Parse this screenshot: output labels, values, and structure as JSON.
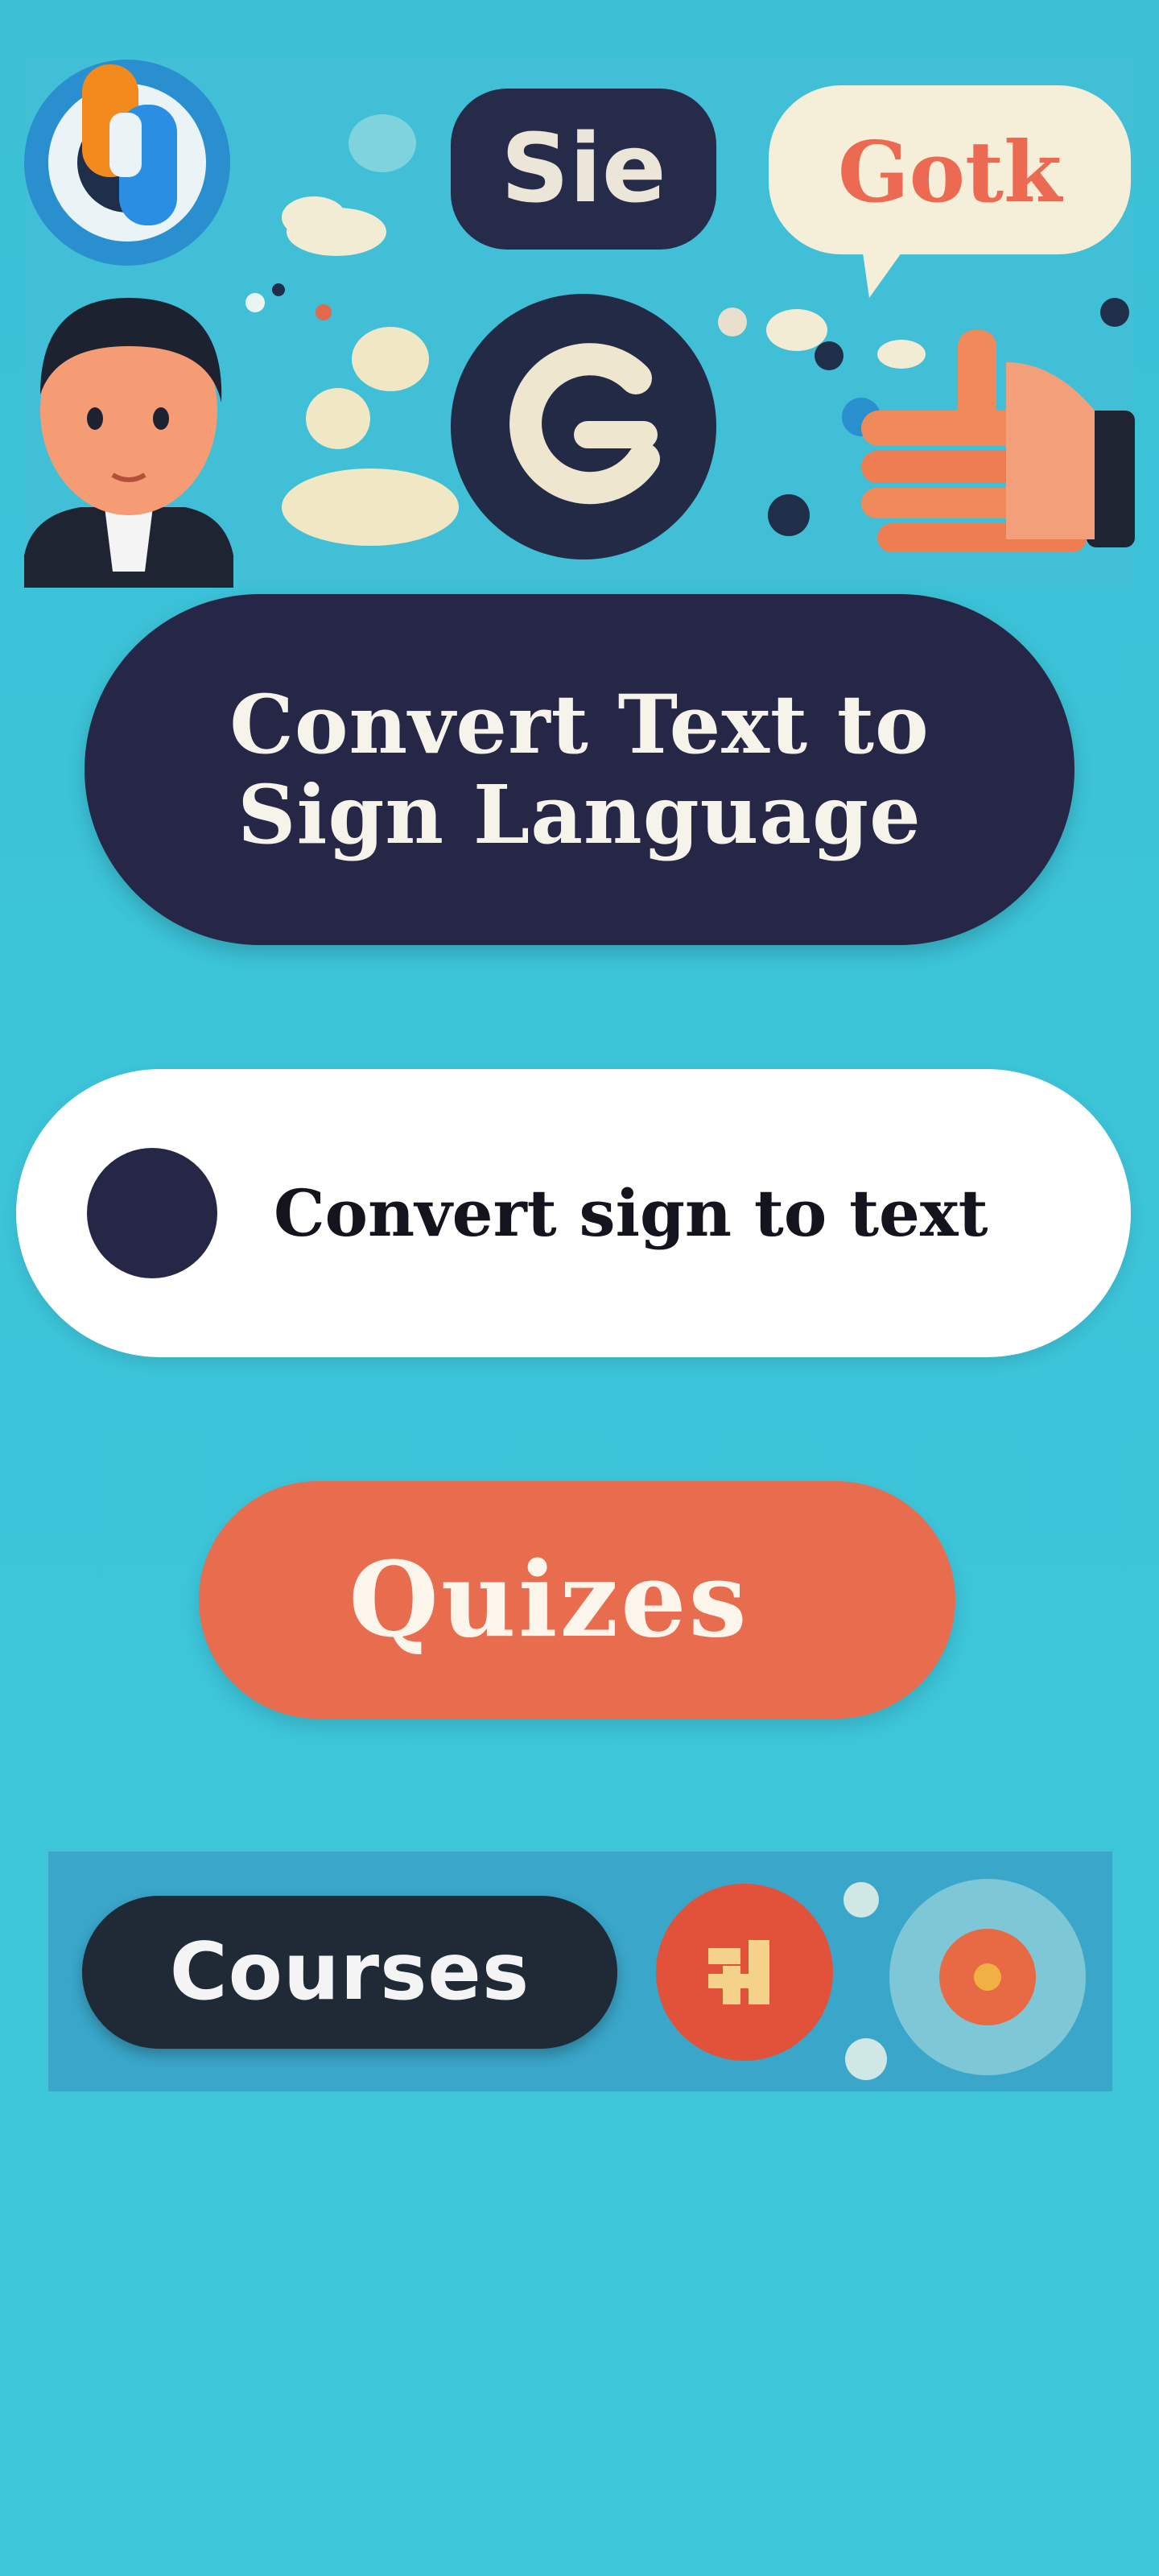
{
  "hero": {
    "badge_text": "Sie",
    "speech_bubble_text": "Gotk"
  },
  "buttons": {
    "text_to_sign": "Convert Text to Sign Language",
    "sign_to_text": "Convert sign to text",
    "quizes": "Quizes",
    "courses": "Courses"
  },
  "colors": {
    "background": "#3cc3d8",
    "navy": "#262646",
    "coral": "#e86d4f",
    "white": "#ffffff"
  }
}
